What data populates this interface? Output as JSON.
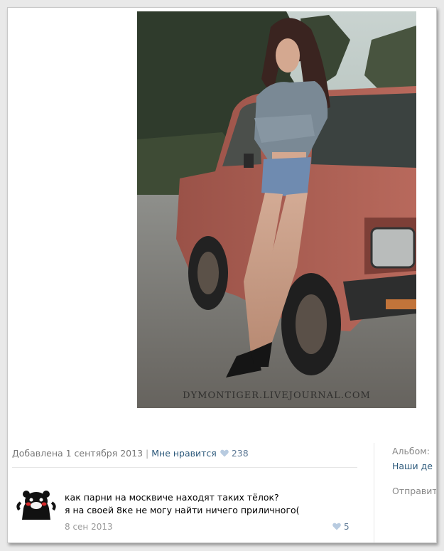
{
  "photo": {
    "watermark": "DYMONTIGER.LIVEJOURNAL.COM"
  },
  "meta": {
    "added": "Добавлена 1 сентября 2013",
    "separator": "|",
    "like_label": "Мне нравится",
    "like_count": "238"
  },
  "sidebar": {
    "album_label": "Альбом:",
    "album_name": "Наши де",
    "sender_label": "Отправит"
  },
  "comment": {
    "line1": "как парни на москвиче находят таких тёлок?",
    "line2": "я на своей 8ке не могу найти ничего приличного(",
    "date": "8 сен 2013",
    "like_count": "5"
  },
  "colors": {
    "link": "#2b587a",
    "muted": "#777777",
    "heart": "#b8cbe0"
  }
}
